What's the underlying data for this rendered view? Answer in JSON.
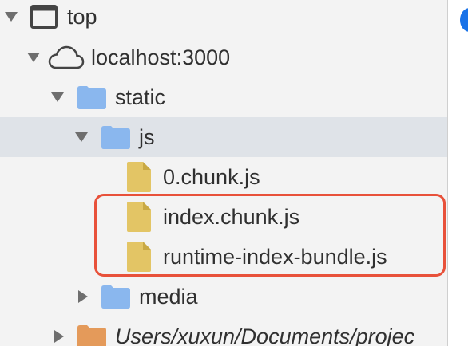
{
  "tree": {
    "nodes": [
      {
        "label": "top",
        "icon": "frame-icon",
        "expanded": true
      },
      {
        "label": "localhost:3000",
        "icon": "cloud-icon",
        "expanded": true
      },
      {
        "label": "static",
        "icon": "folder-icon",
        "expanded": true
      },
      {
        "label": "js",
        "icon": "folder-icon",
        "expanded": true,
        "selected": true
      },
      {
        "label": "0.chunk.js",
        "icon": "file-icon"
      },
      {
        "label": "index.chunk.js",
        "icon": "file-icon",
        "highlighted": true
      },
      {
        "label": "runtime-index-bundle.js",
        "icon": "file-icon",
        "highlighted": true
      },
      {
        "label": "media",
        "icon": "folder-icon",
        "expanded": false
      },
      {
        "label": "Users/xuxun/Documents/projec",
        "icon": "folder-orange-icon",
        "expanded": false
      }
    ]
  },
  "colors": {
    "folder": "#8ab7ee",
    "file": "#e3c565",
    "folder_orange": "#e49a5a",
    "highlight": "#e8513a",
    "selection": "#dfe3e8"
  }
}
